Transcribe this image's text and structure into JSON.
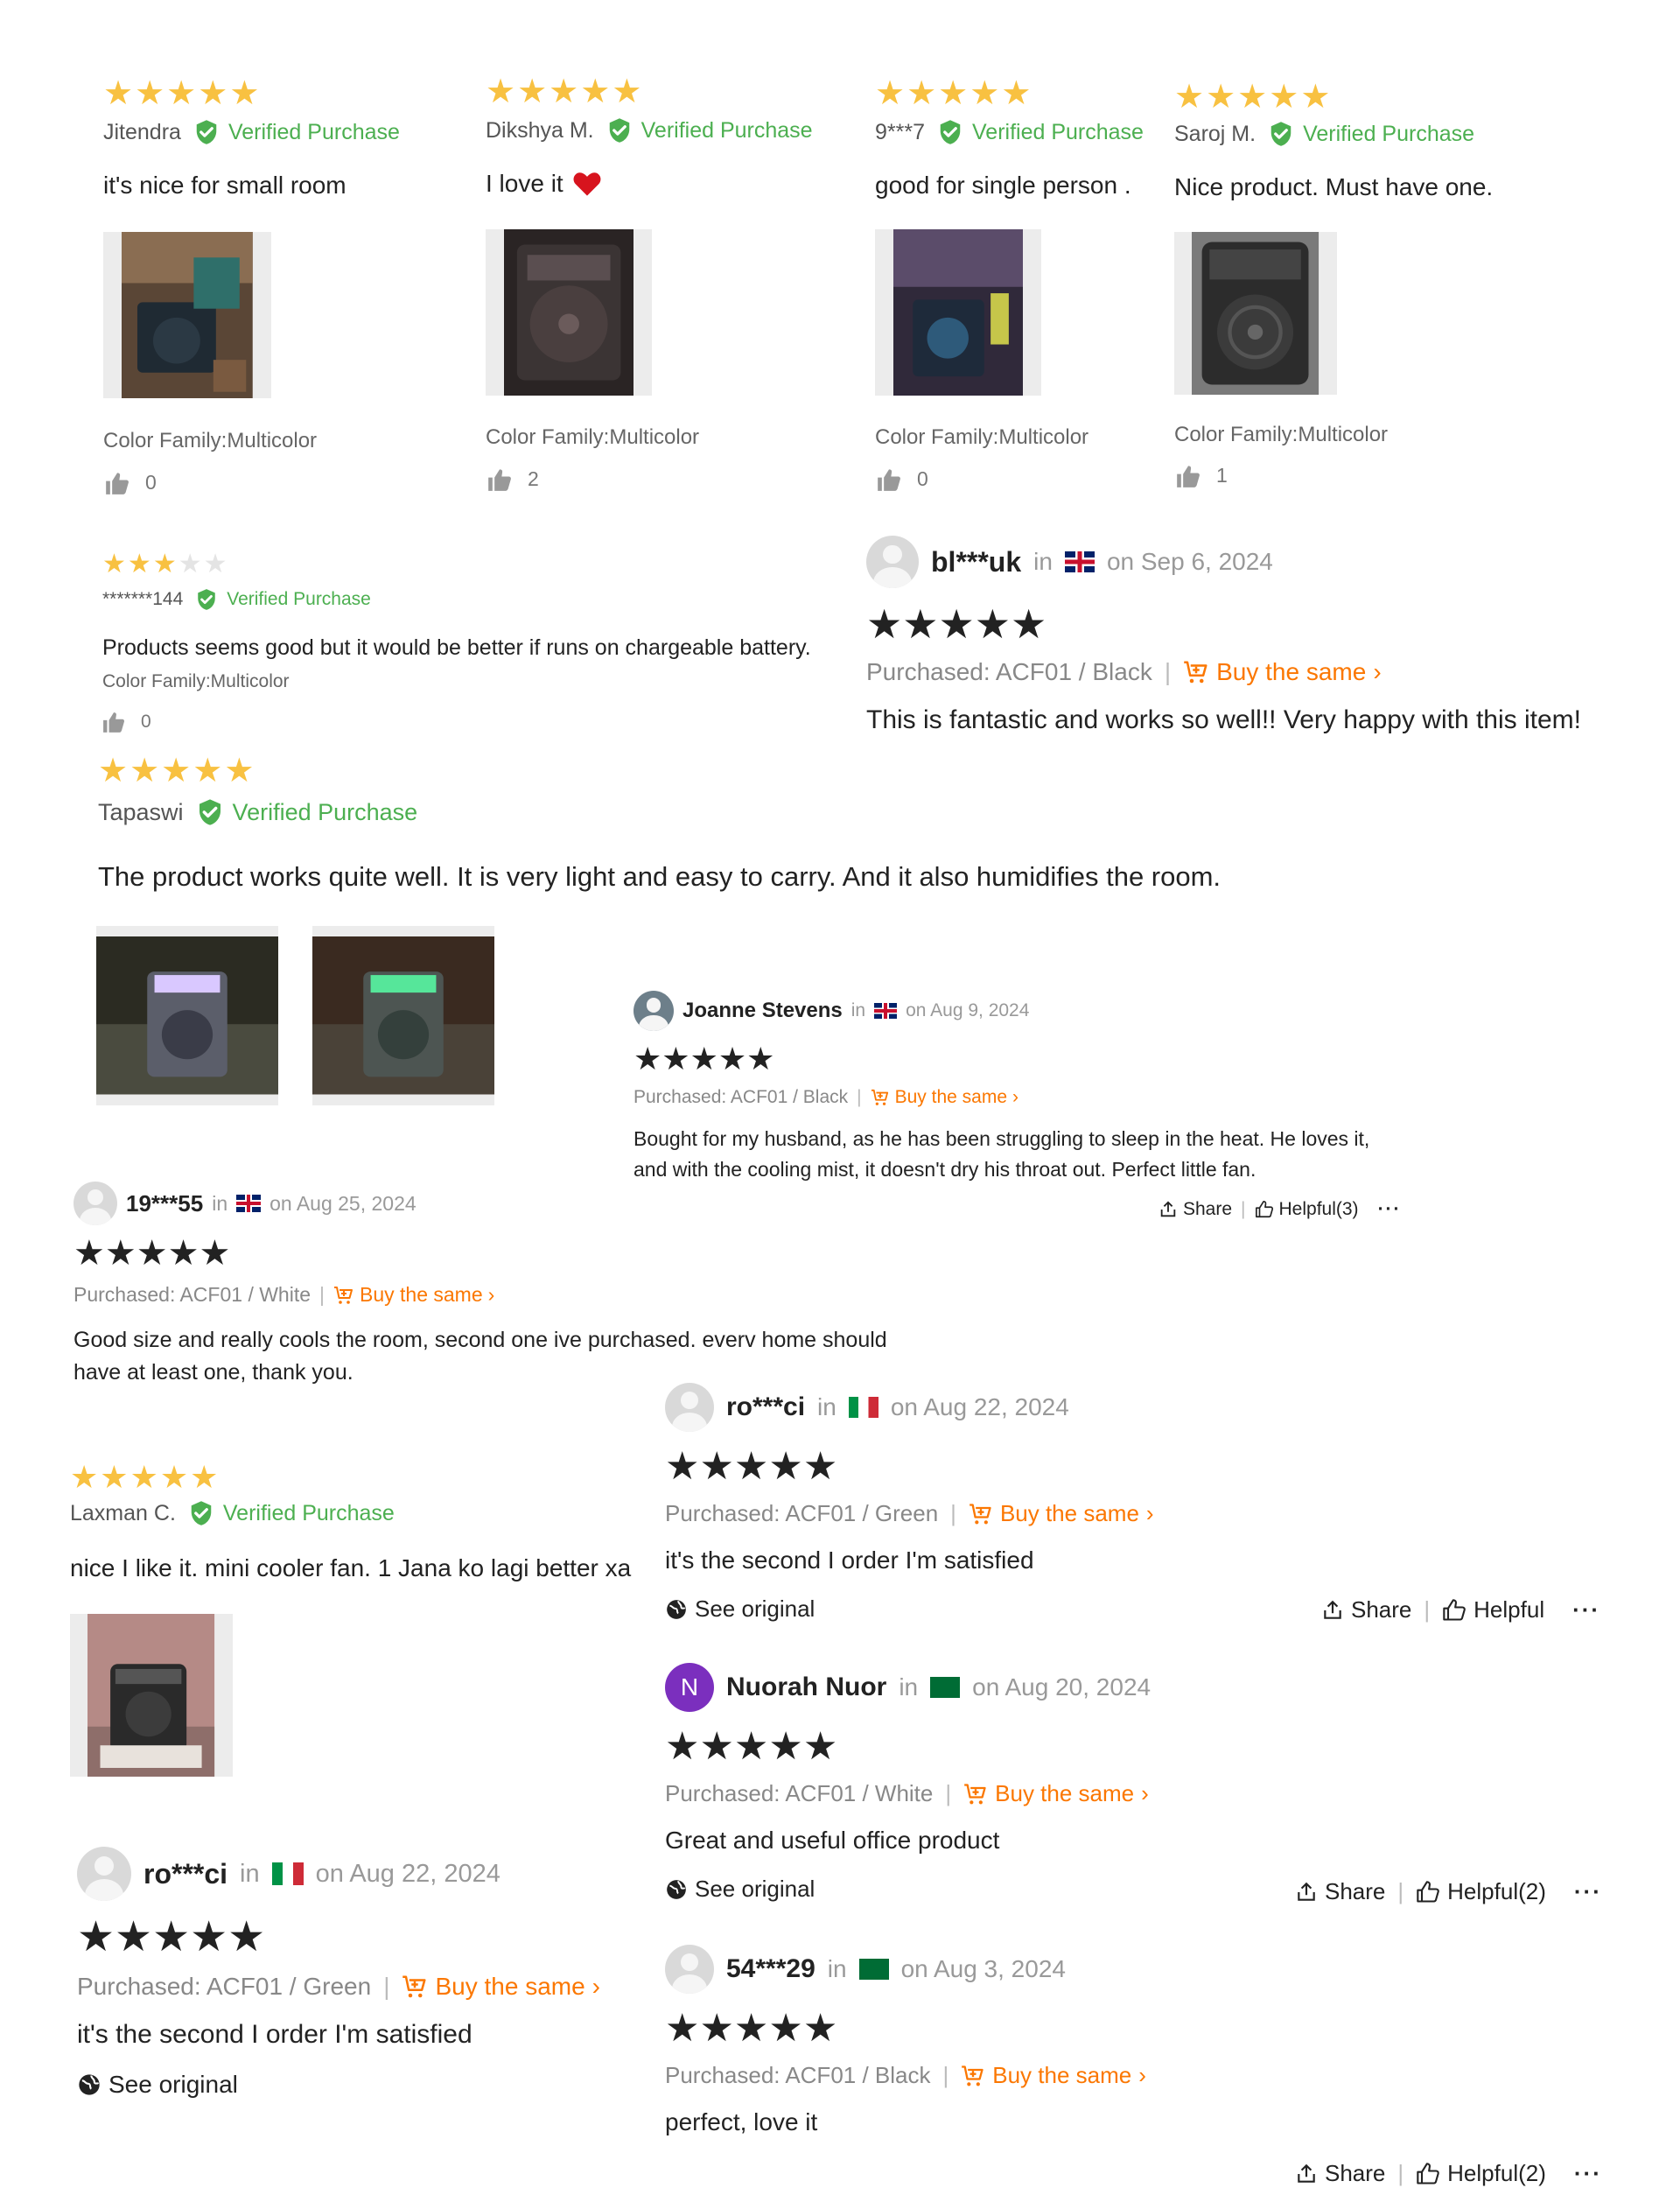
{
  "colors": {
    "star_gold": "#f8c141",
    "verified_green": "#4caf50",
    "temu_orange": "#fb7701",
    "nuorah_avatar": "#7b2fbe"
  },
  "verified_label": "Verified Purchase",
  "temu_common": {
    "in": "in",
    "buy_same": "Buy the same",
    "see_original": "See original",
    "share": "Share",
    "more": "···"
  },
  "daraz": [
    {
      "name": "Jitendra",
      "rating": 5,
      "text": "it's nice for small room",
      "variant": "Color Family:Multicolor",
      "likes": "0"
    },
    {
      "name": "Dikshya M.",
      "rating": 5,
      "text": "I love it",
      "text_icon": "heart-emoji",
      "variant": "Color Family:Multicolor",
      "likes": "2"
    },
    {
      "name": "9***7",
      "rating": 5,
      "text": "good for single person .",
      "variant": "Color Family:Multicolor",
      "likes": "0"
    },
    {
      "name": "Saroj M.",
      "rating": 5,
      "text": "Nice product. Must have one.",
      "variant": "Color Family:Multicolor",
      "likes": "1"
    },
    {
      "name": "*******144",
      "rating": 3,
      "text": "Products seems good but it would be better if runs on chargeable battery.",
      "variant": "Color Family:Multicolor",
      "likes": "0"
    },
    {
      "name": "Tapaswi",
      "rating": 5,
      "text": "The product works quite well. It is very light and easy to carry. And it also humidifies the room."
    },
    {
      "name": "Laxman C.",
      "rating": 5,
      "text": "nice I like it. mini cooler fan. 1 Jana ko lagi better xa"
    }
  ],
  "temu": [
    {
      "name": "bl***uk",
      "flag": "uk",
      "date": "on Sep 6, 2024",
      "rating": 5,
      "purchased": "Purchased: ACF01 / Black",
      "text": "This is fantastic and works so well!! Very happy with this item!"
    },
    {
      "name": "Joanne Stevens",
      "flag": "uk",
      "date": "on Aug 9, 2024",
      "rating": 5,
      "purchased": "Purchased: ACF01 / Black",
      "text_lines": [
        "Bought for my husband, as he has been struggling to sleep in the heat. He loves it,",
        "and with the cooling mist, it doesn't dry his throat out. Perfect little fan."
      ],
      "helpful": "Helpful(3)"
    },
    {
      "name": "19***55",
      "flag": "uk",
      "date": "on Aug 25, 2024",
      "rating": 5,
      "purchased": "Purchased: ACF01 / White",
      "text_lines": [
        "Good size and really cools the room, second one ive purchased. everv home should",
        "have at least one, thank you."
      ]
    },
    {
      "name": "ro***ci",
      "flag": "it",
      "date": "on Aug 22, 2024",
      "rating": 5,
      "purchased": "Purchased: ACF01 / Green",
      "text": "it's the second I order I'm satisfied",
      "helpful": "Helpful"
    },
    {
      "name": "Nuorah Nuor",
      "initial": "N",
      "flag": "sa",
      "date": "on Aug 20, 2024",
      "rating": 5,
      "purchased": "Purchased: ACF01 / White",
      "text": "Great and useful office product",
      "helpful": "Helpful(2)"
    },
    {
      "name": "ro***ci",
      "flag": "it",
      "date": "on Aug 22, 2024",
      "rating": 5,
      "purchased": "Purchased: ACF01 / Green",
      "text": "it's the second I order I'm satisfied"
    },
    {
      "name": "54***29",
      "flag": "sa",
      "date": "on Aug 3, 2024",
      "rating": 5,
      "purchased": "Purchased: ACF01 / Black",
      "text": "perfect, love it",
      "helpful": "Helpful(2)"
    }
  ]
}
